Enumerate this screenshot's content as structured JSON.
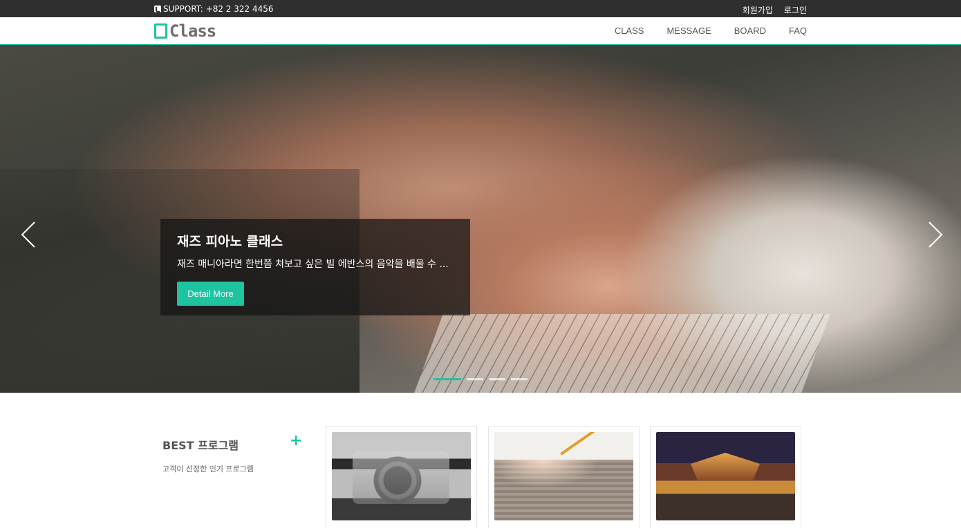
{
  "topbar": {
    "support": "SUPPORT: +82 2 322 4456",
    "signup": "회원가입",
    "login": "로그인"
  },
  "nav": {
    "logo_text": "Class",
    "items": [
      "CLASS",
      "MESSAGE",
      "BOARD",
      "FAQ"
    ]
  },
  "hero": {
    "title": "재즈 피아노 클래스",
    "description": "재즈 매니아라면 한번쯤 쳐보고 싶은 빌 에반스의 음악을 배울 수 ...",
    "button": "Detail More",
    "slide_count": 4,
    "active_slide": 1
  },
  "best": {
    "title": "BEST 프로그램",
    "plus": "+",
    "subtitle": "고객이 선정한 인기 프로그램"
  },
  "colors": {
    "accent": "#1ec3a0",
    "topbar": "#2f2f2f"
  }
}
